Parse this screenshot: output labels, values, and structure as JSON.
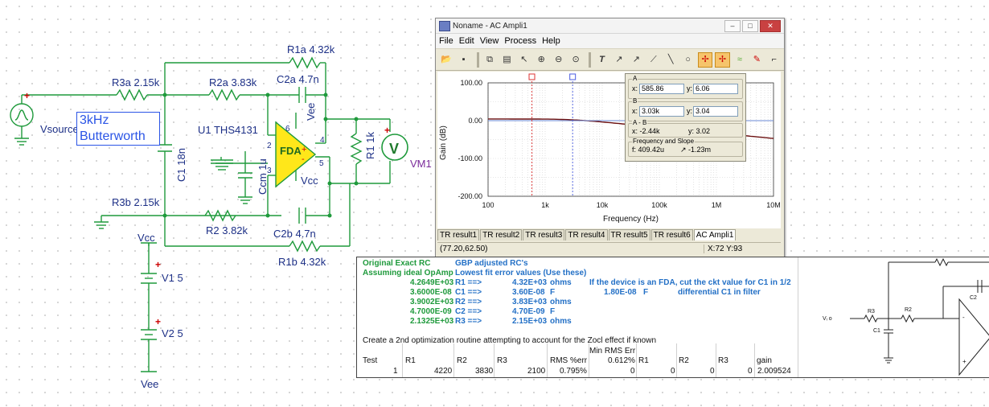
{
  "schematic": {
    "labels": {
      "vsource": "Vsource",
      "r3a": "R3a 2.15k",
      "r2a": "R2a 3.83k",
      "r1a": "R1a 4.32k",
      "c2a": "C2a 4.7n",
      "vee_top": "Vee",
      "u1": "U1 THS4131",
      "fda": "FDA",
      "c1": "C1 18n",
      "ccm": "Ccm 1u",
      "r1": "R1 1k",
      "vm1": "VM1",
      "vcc_mid": "Vcc",
      "r3b": "R3b 2.15k",
      "r2": "R2 3.82k",
      "c2b": "C2b 4.7n",
      "r1b": "R1b 4.32k",
      "vcc_supply": "Vcc",
      "v1": "V1 5",
      "v2": "V2 5",
      "vee_supply": "Vee",
      "pin6": "6",
      "pin2": "2",
      "pin4": "4",
      "pin3": "3",
      "pin5": "5",
      "plus": "+",
      "minus": "-"
    },
    "filter_box": [
      "3kHz",
      "Butterworth"
    ]
  },
  "window": {
    "title": "Noname - AC Ampli1",
    "controls": {
      "minimize": "–",
      "maximize": "□",
      "close": "✕"
    },
    "menu": [
      "File",
      "Edit",
      "View",
      "Process",
      "Help"
    ],
    "toolbar_icons": [
      "open-icon",
      "save-icon",
      "copy-icon",
      "paste-icon",
      "pointer-icon",
      "zoom-in-icon",
      "zoom-out-icon",
      "zoom-fit-icon",
      "text-icon",
      "probe-icon",
      "probe2-icon",
      "slope-icon",
      "line-icon",
      "circle-icon",
      "cursor-a-icon",
      "cursor-b-icon",
      "wave-icon",
      "marker-icon",
      "corner-icon"
    ],
    "plot": {
      "y_axis_label": "Gain (dB)",
      "x_axis_label": "Frequency (Hz)",
      "y_ticks": [
        "100.00",
        "0.00",
        "-100.00",
        "-200.00"
      ],
      "x_ticks": [
        "100",
        "1k",
        "10k",
        "100k",
        "1M",
        "10M"
      ],
      "cursor_a_flag": "a",
      "cursor_b_flag": "b"
    },
    "cursor_panel": {
      "a_title": "A",
      "a_x_label": "x:",
      "a_x": "585.86",
      "a_y_label": "y:",
      "a_y": "6.06",
      "b_title": "B",
      "b_x_label": "x:",
      "b_x": "3.03k",
      "b_y_label": "y:",
      "b_y": "3.04",
      "ab_title": "A - B",
      "ab_x": "x:  -2.44k",
      "ab_y": "y: 3.02",
      "fs_title": "Frequency and Slope",
      "fs_f": "f:  409.42u",
      "fs_slope": "-1.23m"
    },
    "tabs": [
      "TR result1",
      "TR result2",
      "TR result3",
      "TR result4",
      "TR result5",
      "TR result6",
      "AC Ampli1"
    ],
    "active_tab": "AC Ampli1",
    "status_left": "(77.20,62.50)",
    "status_right": "X:72  Y:93"
  },
  "sheet": {
    "row1": {
      "a": "Original Exact RC",
      "b": "GBP adjusted RC's"
    },
    "row2": {
      "a": "Assuming ideal OpAmp",
      "b": "Lowest fit error values (Use these)"
    },
    "rows": [
      {
        "orig": "4.2649E+03",
        "name": "R1 ==>",
        "val": "4.32E+03",
        "unit": "ohms",
        "note": "If the device is an FDA, cut the ckt value for C1 in 1/2"
      },
      {
        "orig": "3.6000E-08",
        "name": "C1 ==>",
        "val": "3.60E-08",
        "unit": "F",
        "note2": "1.80E-08",
        "note2_unit": "F",
        "note3": "differential C1 in filter"
      },
      {
        "orig": "3.9002E+03",
        "name": "R2 ==>",
        "val": "3.83E+03",
        "unit": "ohms"
      },
      {
        "orig": "4.7000E-09",
        "name": "C2 ==>",
        "val": "4.70E-09",
        "unit": "F"
      },
      {
        "orig": "2.1325E+03",
        "name": "R3 ==>",
        "val": "2.15E+03",
        "unit": "ohms"
      }
    ],
    "optimize_text": "Create a 2nd optimization routine attempting to account for the Zocl effect if known",
    "min_rms": "Min RMS Err",
    "headers": [
      "Test",
      "R1",
      "R2",
      "R3",
      "RMS %err",
      "0.612%",
      "R1",
      "R2",
      "R3",
      "gain"
    ],
    "data_row": [
      "1",
      "4220",
      "3830",
      "2100",
      "0.795%",
      "0",
      "0",
      "0",
      "0",
      "2.009524"
    ],
    "diagram_labels": {
      "vi": "Vᵢ o",
      "r3": "R3",
      "r2": "R2",
      "c1": "C1",
      "c2": "C2",
      "minus": "-",
      "plus": "+"
    }
  },
  "colors": {
    "accent_green": "#1f9a3c",
    "accent_blue": "#2370c6",
    "schematic_wire": "#1f9a3c",
    "op_amp_fill": "#ffe71a"
  }
}
